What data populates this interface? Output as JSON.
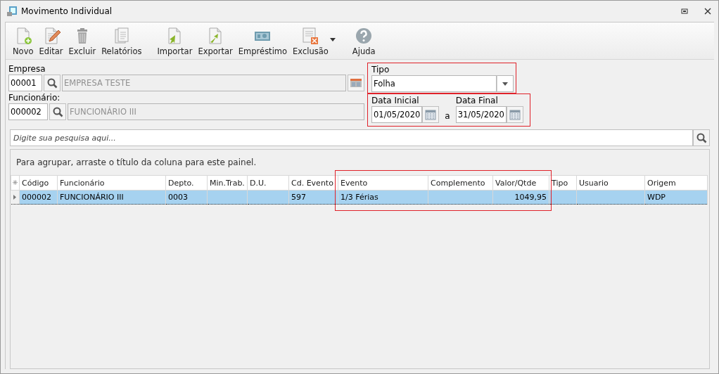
{
  "window": {
    "title": "Movimento Individual"
  },
  "toolbar": [
    {
      "label": "Novo",
      "kind": "new",
      "has_menu": false
    },
    {
      "label": "Editar",
      "kind": "edit",
      "has_menu": false
    },
    {
      "label": "Excluir",
      "kind": "delete",
      "has_menu": false
    },
    {
      "label": "Relatórios",
      "kind": "reports",
      "has_menu": false
    },
    {
      "label": "Importar",
      "kind": "import",
      "has_menu": false
    },
    {
      "label": "Exportar",
      "kind": "export",
      "has_menu": false
    },
    {
      "label": "Empréstimo",
      "kind": "loan",
      "has_menu": false
    },
    {
      "label": "Exclusão",
      "kind": "batch-delete",
      "has_menu": true
    },
    {
      "label": "Ajuda",
      "kind": "help",
      "has_menu": false
    }
  ],
  "empresa": {
    "label": "Empresa",
    "code": "00001",
    "name": "EMPRESA TESTE"
  },
  "funcionario": {
    "label": "Funcionário:",
    "code": "000002",
    "name": "FUNCIONÁRIO III"
  },
  "tipo": {
    "label": "Tipo",
    "value": "Folha"
  },
  "period": {
    "start_label": "Data Inicial",
    "start": "01/05/2020",
    "separator": "a",
    "end_label": "Data Final",
    "end": "31/05/2020"
  },
  "search": {
    "placeholder": "Digite sua pesquisa aqui..."
  },
  "grid": {
    "group_hint": "Para agrupar, arraste o título da coluna para este painel.",
    "columns": [
      {
        "label": "Código"
      },
      {
        "label": "Funcionário"
      },
      {
        "label": "Depto."
      },
      {
        "label": "Min.Trab."
      },
      {
        "label": "D.U."
      },
      {
        "label": "Cd. Evento"
      },
      {
        "label": "Evento"
      },
      {
        "label": "Complemento"
      },
      {
        "label": "Valor/Qtde"
      },
      {
        "label": "Tipo"
      },
      {
        "label": "Usuario"
      },
      {
        "label": "Origem"
      }
    ],
    "rows": [
      {
        "selected": true,
        "cells": [
          "000002",
          "FUNCIONÁRIO III",
          "0003",
          null,
          null,
          "597",
          "1/3 Férias",
          null,
          "1049,95",
          null,
          null,
          "WDP"
        ]
      }
    ]
  }
}
